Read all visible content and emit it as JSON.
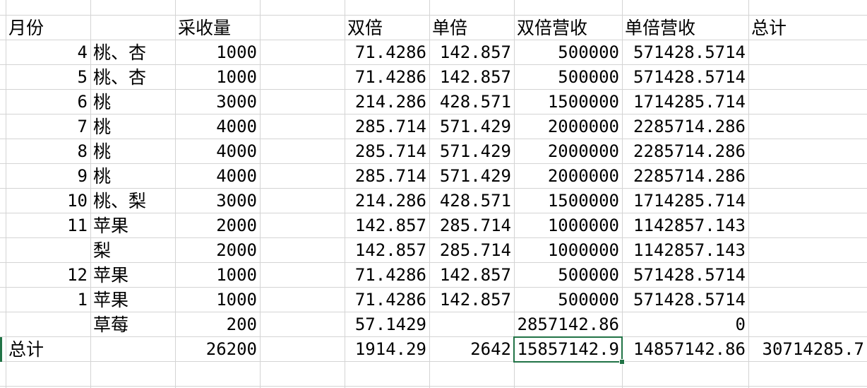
{
  "sheet": {
    "columns": [
      "月份",
      "",
      "采收量",
      "",
      "双倍",
      "单倍",
      "双倍营收",
      "单倍营收",
      "总计"
    ],
    "rows": [
      [
        "",
        "",
        "",
        "",
        "",
        "",
        "",
        "",
        ""
      ],
      [
        "月份",
        "",
        "采收量",
        "",
        "双倍",
        "单倍",
        "双倍营收",
        "单倍营收",
        "总计"
      ],
      [
        "4",
        "桃、杏",
        "1000",
        "",
        "71.4286",
        "142.857",
        "500000",
        "571428.5714",
        ""
      ],
      [
        "5",
        "桃、杏",
        "1000",
        "",
        "71.4286",
        "142.857",
        "500000",
        "571428.5714",
        ""
      ],
      [
        "6",
        "桃",
        "3000",
        "",
        "214.286",
        "428.571",
        "1500000",
        "1714285.714",
        ""
      ],
      [
        "7",
        "桃",
        "4000",
        "",
        "285.714",
        "571.429",
        "2000000",
        "2285714.286",
        ""
      ],
      [
        "8",
        "桃",
        "4000",
        "",
        "285.714",
        "571.429",
        "2000000",
        "2285714.286",
        ""
      ],
      [
        "9",
        "桃",
        "4000",
        "",
        "285.714",
        "571.429",
        "2000000",
        "2285714.286",
        ""
      ],
      [
        "10",
        "桃、梨",
        "3000",
        "",
        "214.286",
        "428.571",
        "1500000",
        "1714285.714",
        ""
      ],
      [
        "11",
        "苹果",
        "2000",
        "",
        "142.857",
        "285.714",
        "1000000",
        "1142857.143",
        ""
      ],
      [
        "",
        "梨",
        "2000",
        "",
        "142.857",
        "285.714",
        "1000000",
        "1142857.143",
        ""
      ],
      [
        "12",
        "苹果",
        "1000",
        "",
        "71.4286",
        "142.857",
        "500000",
        "571428.5714",
        ""
      ],
      [
        "1",
        "苹果",
        "1000",
        "",
        "71.4286",
        "142.857",
        "500000",
        "571428.5714",
        ""
      ],
      [
        "",
        "草莓",
        "200",
        "",
        "57.1429",
        "",
        "2857142.86",
        "0",
        ""
      ],
      [
        "总计",
        "",
        "26200",
        "",
        "1914.29",
        "2642",
        "15857142.9",
        "14857142.86",
        "30714285.7"
      ],
      [
        "",
        "",
        "",
        "",
        "",
        "",
        "",
        "",
        ""
      ]
    ],
    "accent_color": "#217346"
  }
}
